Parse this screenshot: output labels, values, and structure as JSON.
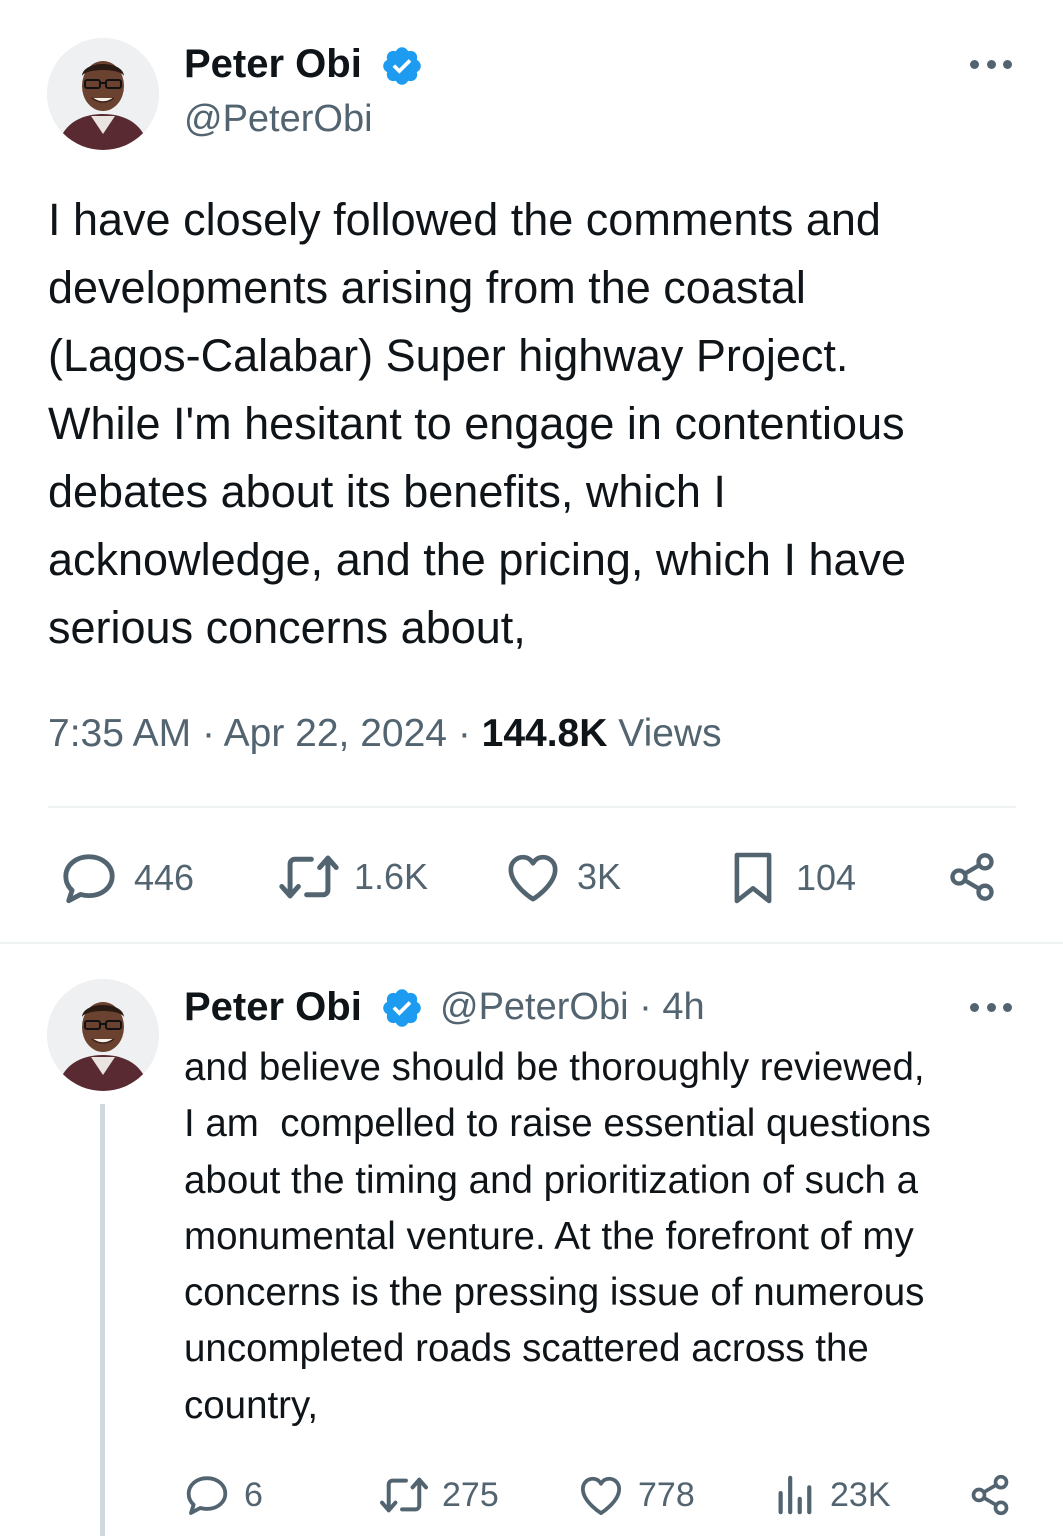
{
  "main_tweet": {
    "author_name": "Peter Obi",
    "author_handle": "@PeterObi",
    "text_lines": [
      "I have closely followed the comments and",
      "developments arising from the coastal",
      "(Lagos-Calabar) Super highway Project.",
      "While I'm hesitant to engage in contentious",
      "debates about its benefits, which I",
      "acknowledge, and the pricing, which I have",
      "serious concerns about,"
    ],
    "time": "7:35 AM",
    "date": "Apr 22, 2024",
    "views_count": "144.8K",
    "views_label": "Views",
    "separator": "·",
    "stats": {
      "replies": "446",
      "reposts": "1.6K",
      "likes": "3K",
      "bookmarks": "104"
    },
    "icons": [
      "verified-badge-icon",
      "more-icon",
      "reply-icon",
      "repost-icon",
      "like-icon",
      "bookmark-icon",
      "share-icon"
    ]
  },
  "reply_tweet": {
    "author_name": "Peter Obi",
    "author_handle": "@PeterObi",
    "age": "· 4h",
    "text_lines": [
      "and believe should be thoroughly reviewed,",
      "I am  compelled to raise essential questions",
      "about the timing and prioritization of such a",
      "monumental venture. At the forefront of my",
      "concerns is the pressing issue of numerous",
      "uncompleted roads scattered across the",
      "country,"
    ],
    "stats": {
      "replies": "6",
      "reposts": "275",
      "likes": "778",
      "views": "23K"
    },
    "icons": [
      "verified-badge-icon",
      "more-icon",
      "reply-icon",
      "repost-icon",
      "like-icon",
      "views-icon",
      "share-icon"
    ]
  },
  "colors": {
    "text": "#0f1419",
    "secondary": "#536471",
    "verified": "#1d9bf0",
    "divider": "#eff3f4",
    "thread_line": "#cfd9de"
  }
}
